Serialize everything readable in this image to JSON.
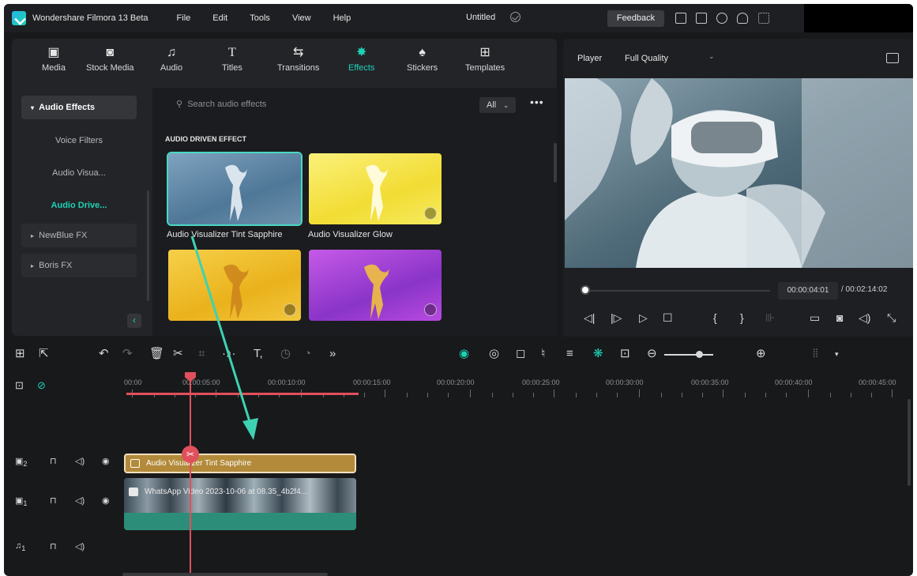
{
  "titlebar": {
    "app_name": "Wondershare Filmora 13 Beta",
    "menus": [
      "File",
      "Edit",
      "Tools",
      "View",
      "Help"
    ],
    "doc_title": "Untitled",
    "feedback": "Feedback"
  },
  "toolbar": {
    "items": [
      {
        "label": "Media",
        "icon": "media-icon"
      },
      {
        "label": "Stock Media",
        "icon": "stock-media-icon"
      },
      {
        "label": "Audio",
        "icon": "music-note-icon"
      },
      {
        "label": "Titles",
        "icon": "text-t-icon"
      },
      {
        "label": "Transitions",
        "icon": "transitions-icon"
      },
      {
        "label": "Effects",
        "icon": "effects-sparkle-icon",
        "active": true
      },
      {
        "label": "Stickers",
        "icon": "stickers-icon"
      },
      {
        "label": "Templates",
        "icon": "templates-icon"
      }
    ]
  },
  "sidebar": {
    "items": [
      {
        "label": "Audio Effects",
        "selected": true
      },
      {
        "label": "Voice Filters"
      },
      {
        "label": "Audio Visua..."
      },
      {
        "label": "Audio Drive...",
        "active": true
      },
      {
        "label": "NewBlue FX"
      },
      {
        "label": "Boris FX"
      }
    ]
  },
  "content": {
    "search_placeholder": "Search audio effects",
    "filter": "All",
    "section_title": "AUDIO DRIVEN EFFECT",
    "effects": [
      {
        "label": "Audio Visualizer Tint Sapphire",
        "color": "#5f88a8",
        "selected": true
      },
      {
        "label": "Audio Visualizer Glow",
        "color": "#f4e24a"
      },
      {
        "label": "",
        "color": "#f0c22a"
      },
      {
        "label": "",
        "color": "#a44ad6"
      }
    ]
  },
  "player": {
    "label": "Player",
    "quality": "Full Quality",
    "current_time": "00:00:04:01",
    "total_time": "/ 00:02:14:02"
  },
  "timeline": {
    "ruler": [
      "00:00",
      "00:00:05:00",
      "00:00:10:00",
      "00:00:15:00",
      "00:00:20:00",
      "00:00:25:00",
      "00:00:30:00",
      "00:00:35:00",
      "00:00:40:00",
      "00:00:45:00"
    ],
    "tracks": [
      {
        "number": "2",
        "type": "video"
      },
      {
        "number": "1",
        "type": "video"
      },
      {
        "number": "1",
        "type": "audio"
      }
    ],
    "effect_clip": "Audio Visualizer Tint Sapphire",
    "video_clip": "WhatsApp Video 2023-10-06 at 08.35_4b2f4..."
  },
  "colors": {
    "accent": "#1ed1b5",
    "playhead": "#e0505c",
    "effect_clip": "#b28a3a",
    "video_clip": "#2c8e79"
  }
}
